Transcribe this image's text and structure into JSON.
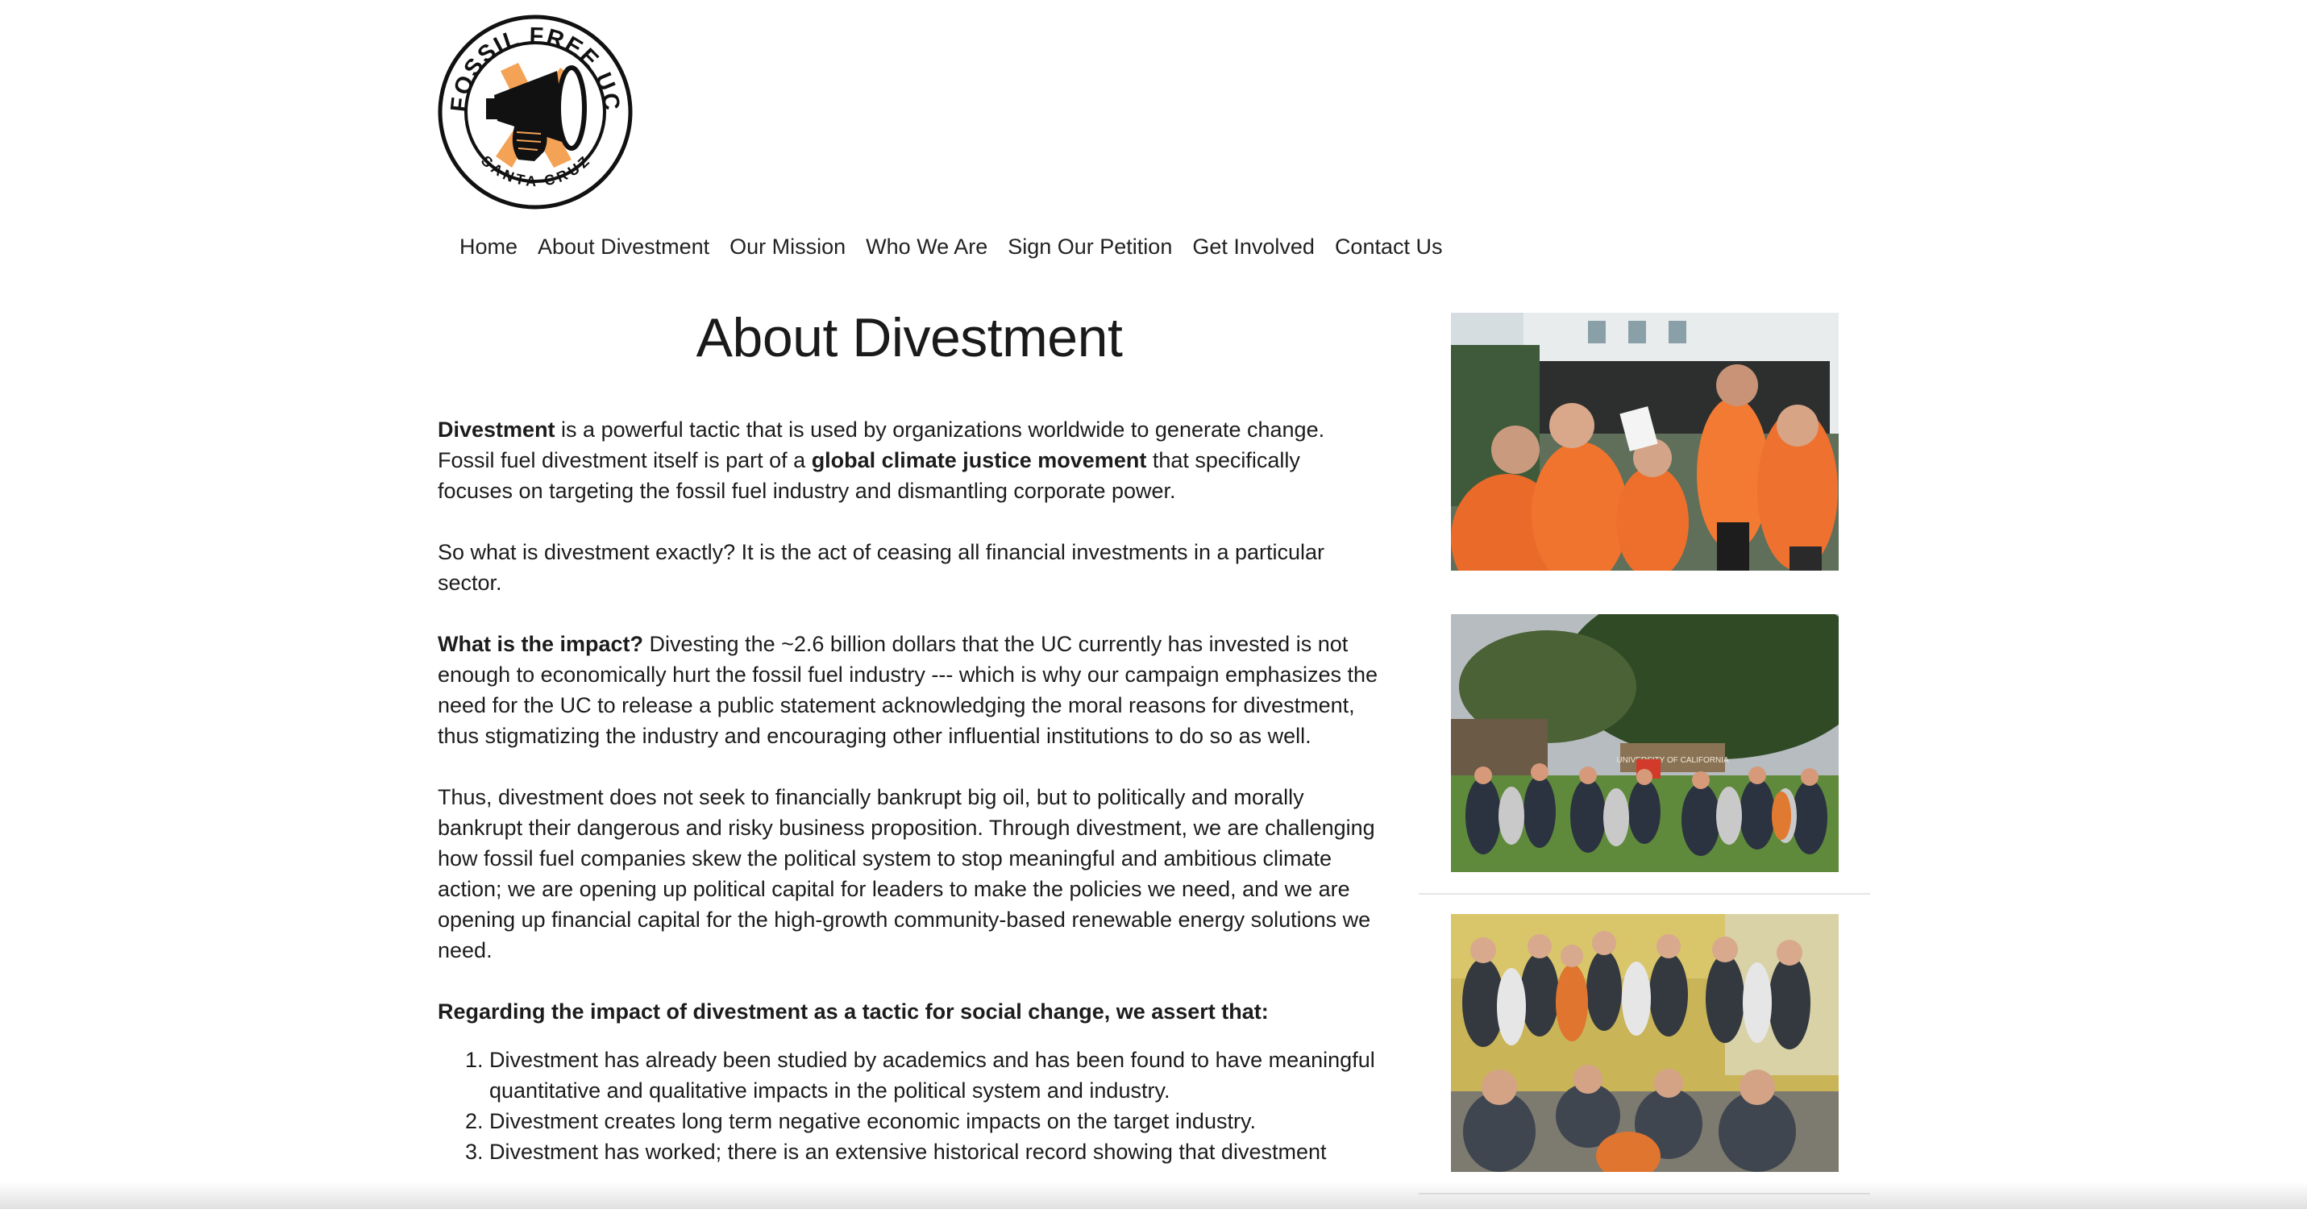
{
  "logo": {
    "top_text": "FOSSIL FREE UC",
    "bottom_text": "SANTA CRUZ",
    "colors": {
      "ink": "#111111",
      "orange": "#f4a255"
    }
  },
  "nav": {
    "items": [
      "Home",
      "About Divestment",
      "Our Mission",
      "Who We Are",
      "Sign Our Petition",
      "Get Involved",
      "Contact Us"
    ]
  },
  "page_title": "About Divestment",
  "paragraphs": {
    "p1": {
      "b1": "Divestment",
      "t1": " is a powerful tactic that is used by organizations worldwide to generate change. Fossil fuel divestment itself is part of a ",
      "b2": "global climate justice movement",
      "t2": " that specifically focuses on targeting the fossil fuel industry and dismantling corporate power."
    },
    "p2": "So what is divestment exactly? It is the act of ceasing all financial investments in a particular sector.",
    "p3": {
      "b1": "What is the impact?",
      "t1": " Divesting the ~2.6 billion dollars that the UC currently has invested is not enough to economically hurt the fossil fuel industry --- which is why our campaign emphasizes the need for the UC to release a public statement acknowledging the moral reasons for divestment, thus stigmatizing the industry and encouraging other influential institutions to do so as well."
    },
    "p4": "Thus, divestment does not seek to financially bankrupt big oil, but to politically and morally bankrupt their dangerous and risky business proposition. Through divestment, we are challenging how fossil fuel companies skew the political system to stop meaningful and ambitious climate action; we are opening up political capital for leaders to make the policies we need, and we are opening up financial capital for the high-growth community-based renewable energy solutions we need.",
    "p5": "Regarding the impact of divestment as a tactic for social change, we assert that:"
  },
  "assertions": [
    "Divestment has already been studied by academics and has been found to have meaningful quantitative and qualitative impacts in the political system and industry.",
    "Divestment creates long term negative economic impacts on the target industry.",
    "Divestment has worked; there is an extensive historical record showing that divestment"
  ],
  "sidebar": {
    "photo2_sign": "UNIVERSITY OF CALIFORNIA"
  },
  "colors": {
    "accent_orange": "#f26a1f",
    "text": "#1c1c1c",
    "divider": "#e6e6e6"
  }
}
